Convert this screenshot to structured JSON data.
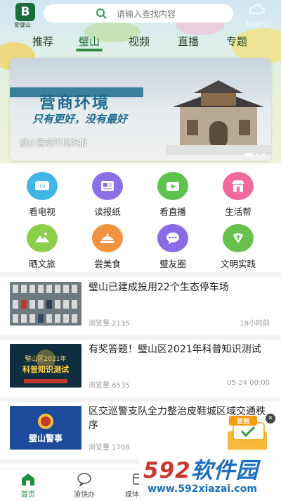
{
  "app": {
    "logo_text": "B",
    "logo_label": "爱璧山"
  },
  "search": {
    "placeholder": "请输入查找内容"
  },
  "weather": {
    "icon": "cloud-icon",
    "temp": "19.27°C"
  },
  "tabs": [
    {
      "label": "推荐",
      "active": false
    },
    {
      "label": "璧山",
      "active": true
    },
    {
      "label": "视频",
      "active": false
    },
    {
      "label": "直播",
      "active": false
    },
    {
      "label": "专题",
      "active": false
    }
  ],
  "banner": {
    "title": "营商环境",
    "subtitle": "只有更好，没有最好",
    "caption": "璧山营商环境海报"
  },
  "services": [
    {
      "label": "看电视",
      "icon": "tv-icon",
      "color": "#3fb6e6"
    },
    {
      "label": "读报纸",
      "icon": "newspaper-icon",
      "color": "#8b70e6"
    },
    {
      "label": "看直播",
      "icon": "video-icon",
      "color": "#5fc24e"
    },
    {
      "label": "生活帮",
      "icon": "shop-icon",
      "color": "#f06aa0"
    },
    {
      "label": "晒文旅",
      "icon": "mountain-icon",
      "color": "#8ccf4c"
    },
    {
      "label": "尝美食",
      "icon": "dish-icon",
      "color": "#f3933f"
    },
    {
      "label": "璧友圈",
      "icon": "chat-icon",
      "color": "#8a6be6"
    },
    {
      "label": "文明实践",
      "icon": "civility-icon",
      "color": "#67c14a"
    }
  ],
  "news": [
    {
      "title": "璧山已建成投用22个生态停车场",
      "views": "浏览量 2135",
      "time": "18小时前"
    },
    {
      "title": "有奖答题！璧山区2021年科普知识测试",
      "views": "浏览量 6535",
      "time": "05-24 00:00"
    },
    {
      "title": "区交巡警支队全力整治皮鞋城区域交通秩序",
      "views": "浏览量 1708",
      "time": ""
    }
  ],
  "news_thumbs": {
    "quiz_line1": "璧山区2021年",
    "quiz_line2": "科普知识测试",
    "police": "璧山警事"
  },
  "bottom_nav": [
    {
      "label": "首页",
      "icon": "home-icon",
      "active": true
    },
    {
      "label": "渝快办",
      "icon": "chat-bubble-icon",
      "active": false
    },
    {
      "label": "媒体矩阵",
      "icon": "media-icon",
      "active": false
    }
  ],
  "signin": {
    "label": "签到"
  },
  "watermark": {
    "brand_num": "592",
    "brand_text": "软件园",
    "url": "www.592xiazai.com"
  }
}
